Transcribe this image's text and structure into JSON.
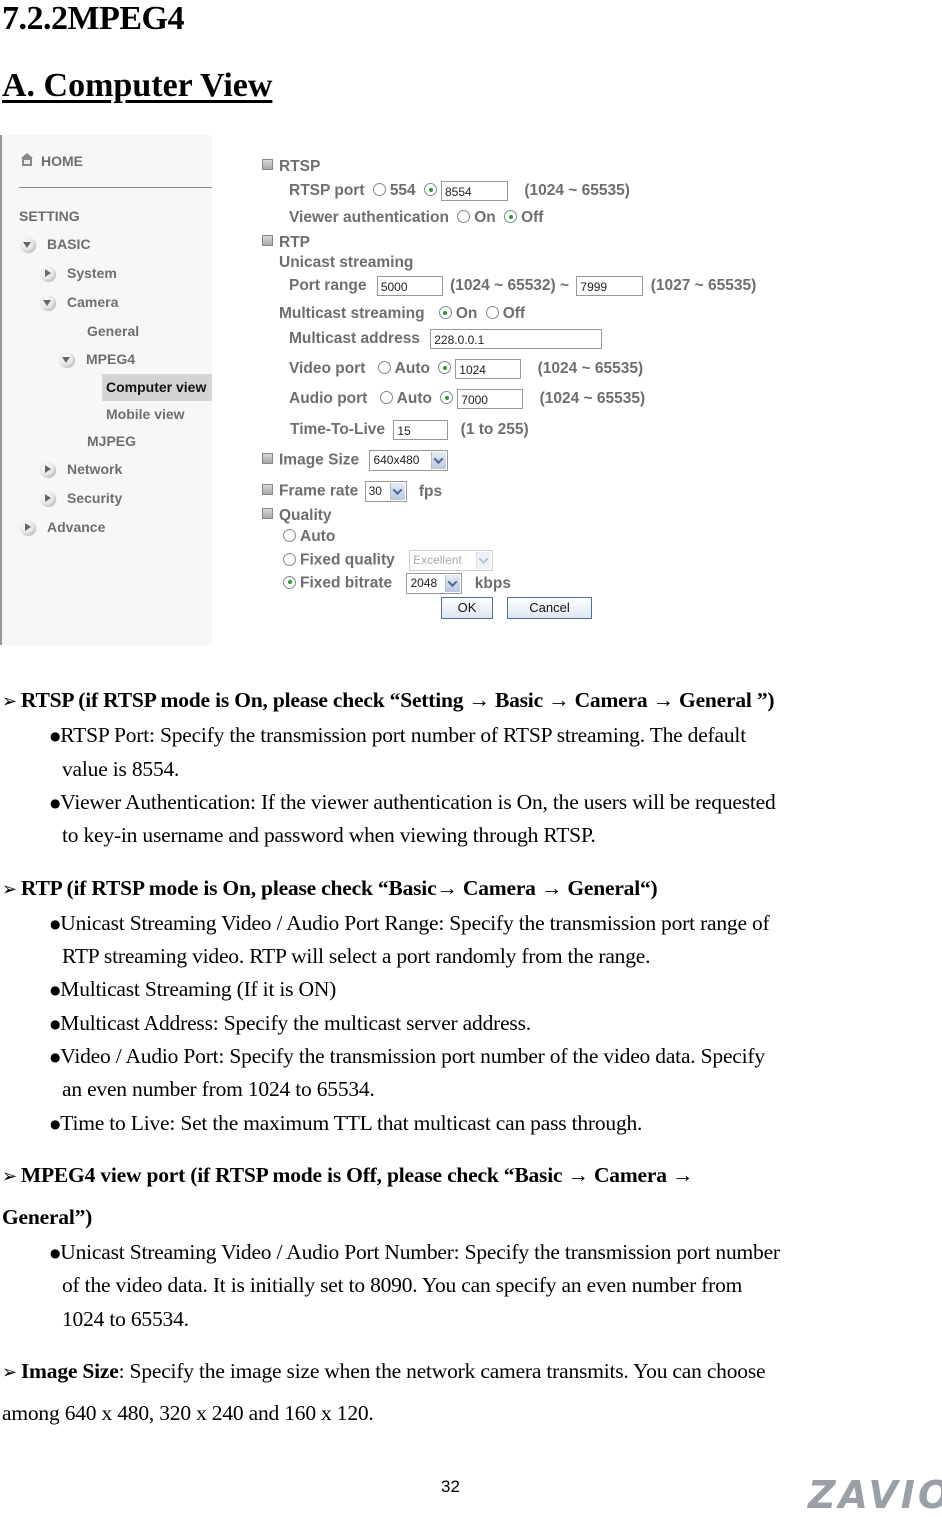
{
  "heading": "7.2.2MPEG4",
  "subheading": "A. Computer View",
  "sidebar": {
    "home": "HOME",
    "setting": "SETTING",
    "items": [
      {
        "label": "BASIC",
        "arrow": "down"
      },
      {
        "label": "System",
        "arrow": "right"
      },
      {
        "label": "Camera",
        "arrow": "down"
      },
      {
        "label": "General"
      },
      {
        "label": "MPEG4",
        "arrow": "down"
      },
      {
        "label": "Computer view",
        "active": true
      },
      {
        "label": "Mobile view"
      },
      {
        "label": "MJPEG"
      },
      {
        "label": "Network",
        "arrow": "right"
      },
      {
        "label": "Security",
        "arrow": "right"
      },
      {
        "label": "Advance",
        "arrow": "right"
      }
    ]
  },
  "form": {
    "rtsp": {
      "title": "RTSP",
      "port_label": "RTSP port",
      "port_default": "554",
      "port_value": "8554",
      "port_range": "(1024 ~ 65535)",
      "auth_label": "Viewer authentication",
      "auth_on": "On",
      "auth_off": "Off",
      "auth_selected": "Off"
    },
    "rtp": {
      "title": "RTP",
      "unicast_label": "Unicast streaming",
      "port_range_label": "Port range",
      "port_from": "5000",
      "port_from_range": "(1024 ~ 65532) ~",
      "port_to": "7999",
      "port_to_range": "(1027 ~ 65535)",
      "multicast_label": "Multicast streaming",
      "multicast_on": "On",
      "multicast_off": "Off",
      "multicast_selected": "On",
      "address_label": "Multicast address",
      "address_value": "228.0.0.1",
      "video_port_label": "Video port",
      "video_auto": "Auto",
      "video_port_value": "1024",
      "video_port_range": "(1024 ~ 65535)",
      "audio_port_label": "Audio port",
      "audio_auto": "Auto",
      "audio_port_value": "7000",
      "audio_port_range": "(1024 ~ 65535)",
      "ttl_label": "Time-To-Live",
      "ttl_value": "15",
      "ttl_range": "(1 to 255)"
    },
    "image_size": {
      "label": "Image Size",
      "value": "640x480"
    },
    "frame_rate": {
      "label": "Frame rate",
      "value": "30",
      "unit": "fps"
    },
    "quality": {
      "label": "Quality",
      "auto": "Auto",
      "fixed_quality": "Fixed quality",
      "fixed_quality_value": "Excellent",
      "fixed_bitrate": "Fixed bitrate",
      "fixed_bitrate_value": "2048",
      "bitrate_unit": "kbps",
      "selected": "Fixed bitrate"
    },
    "ok": "OK",
    "cancel": "Cancel"
  },
  "sections": [
    {
      "title": "RTSP (if RTSP mode is On, please check “Setting → Basic → Camera → General ”)",
      "lines": [
        "RTSP Port: Specify the transmission port number of RTSP streaming. The default",
        "value is 8554.",
        "Viewer Authentication: If the viewer authentication is On, the users will be requested",
        "to key-in username and password when viewing through RTSP."
      ]
    },
    {
      "title": "RTP (if RTSP mode is On, please check “Basic→ Camera → General“)",
      "lines": [
        "Unicast Streaming Video / Audio Port Range: Specify the transmission port range of",
        "RTP streaming video. RTP will select a port randomly from the range.",
        "Multicast Streaming (If it is ON)",
        "Multicast Address: Specify the multicast server address.",
        "Video / Audio Port: Specify the transmission port number of the video data. Specify",
        "an even number from 1024 to 65534.",
        "Time to Live: Set the maximum TTL that multicast can pass through."
      ]
    },
    {
      "title_line1": "MPEG4 view port (if RTSP mode is Off, please check “Basic → Camera →",
      "title_line2": "General”)",
      "lines": [
        "Unicast Streaming Video / Audio Port Number: Specify the transmission port number",
        "of the video data. It is initially set to 8090. You can specify an even number from",
        "1024 to 65534."
      ]
    },
    {
      "title": "Image Size",
      "line1_rest": ": Specify the image size when the network camera transmits. You can choose",
      "line2": "among 640 x 480, 320 x 240 and 160 x 120."
    }
  ],
  "footer": {
    "page_number": "32",
    "logo": "ZAVIO"
  }
}
